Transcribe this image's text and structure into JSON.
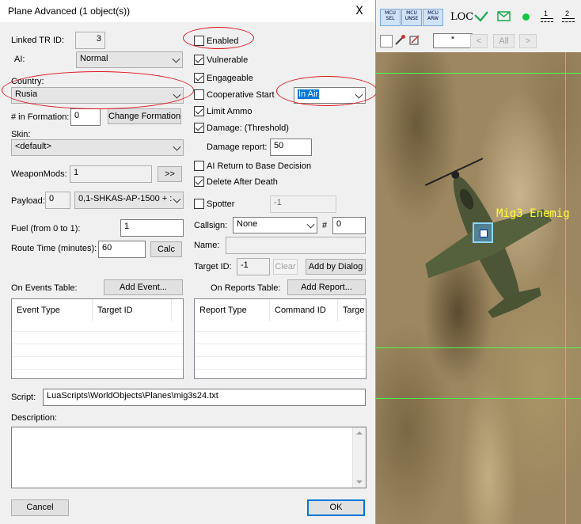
{
  "dialog": {
    "title": "Plane Advanced (1 object(s))",
    "close": "X",
    "linked_tr_id": {
      "label": "Linked TR ID:",
      "value": "3"
    },
    "ai": {
      "label": "AI:",
      "value": "Normal"
    },
    "country": {
      "label": "Country:",
      "value": "Rusia"
    },
    "formation": {
      "label": "# in Formation:",
      "value": "0",
      "button": "Change Formation"
    },
    "skin": {
      "label": "Skin:",
      "value": "<default>"
    },
    "weaponmods": {
      "label": "WeaponMods:",
      "value": "1",
      "button": ">>"
    },
    "payload": {
      "label": "Payload:",
      "id": "0",
      "value": "0,1-SHKAS-AP-1500 + :"
    },
    "fuel": {
      "label": "Fuel (from 0 to 1):",
      "value": "1"
    },
    "route_time": {
      "label": "Route Time (minutes):",
      "value": "60",
      "button": "Calc"
    },
    "checks": {
      "enabled": "Enabled",
      "vulnerable": "Vulnerable",
      "engageable": "Engageable",
      "coop_start": "Cooperative Start",
      "limit_ammo": "Limit Ammo",
      "damage": "Damage: (Threshold)",
      "ai_return": "AI Return to Base Decision",
      "delete_after_death": "Delete After Death",
      "spotter": "Spotter"
    },
    "start_mode": "In Air",
    "damage_report": {
      "label": "Damage report:",
      "value": "50"
    },
    "spotter_value": "-1",
    "callsign": {
      "label": "Callsign:",
      "value": "None",
      "hash": "#",
      "number": "0"
    },
    "name": {
      "label": "Name:",
      "value": ""
    },
    "target_id": {
      "label": "Target ID:",
      "value": "-1",
      "clear": "Clear",
      "add": "Add by Dialog"
    },
    "events": {
      "label": "On Events Table:",
      "button": "Add Event...",
      "columns": [
        "Event Type",
        "Target ID"
      ]
    },
    "reports": {
      "label": "On Reports Table:",
      "button": "Add Report...",
      "columns": [
        "Report Type",
        "Command ID",
        "Targe"
      ]
    },
    "script": {
      "label": "Script:",
      "value": "LuaScripts\\WorldObjects\\Planes\\mig3s24.txt"
    },
    "description": {
      "label": "Description:"
    },
    "cancel": "Cancel",
    "ok": "OK"
  },
  "editor": {
    "toolbar": {
      "mcu_buttons": [
        {
          "line1": "MCU",
          "line2": "SEL"
        },
        {
          "line1": "MCU",
          "line2": "UNSE"
        },
        {
          "line1": "MCU",
          "line2": "ARW"
        }
      ],
      "loc": "LOC",
      "layer1": "1",
      "layer2": "2",
      "filter": "*",
      "prev": "<",
      "all": "All",
      "next": ">"
    },
    "map_label": "Mig3 Enemig"
  },
  "colors": {
    "annotation": "#e0141e",
    "selection": "#0078d7",
    "map_label": "#ffff33",
    "gridline": "#55ff55"
  }
}
